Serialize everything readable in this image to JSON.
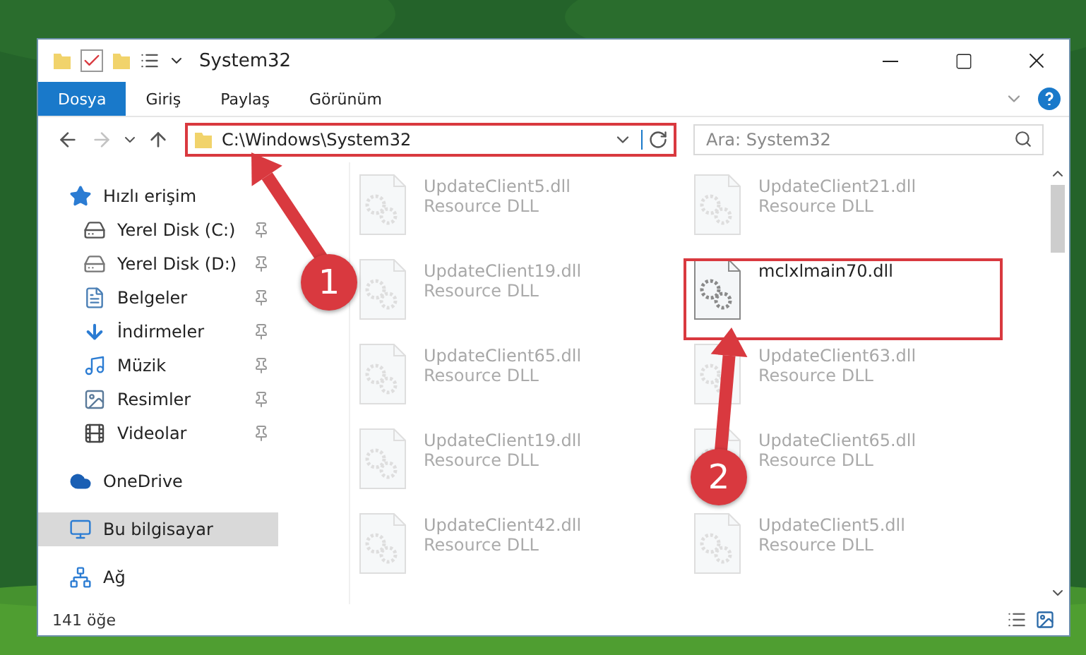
{
  "window": {
    "title": "System32"
  },
  "ribbon": {
    "tabs": [
      {
        "label": "Dosya",
        "selected": true
      },
      {
        "label": "Giriş",
        "selected": false
      },
      {
        "label": "Paylaş",
        "selected": false
      },
      {
        "label": "Görünüm",
        "selected": false
      }
    ]
  },
  "address_bar": {
    "path": "C:\\Windows\\System32",
    "search": {
      "placeholder": "Ara: System32"
    }
  },
  "sidebar": {
    "items": [
      {
        "label": "Hızlı erişim",
        "kind": "quick",
        "selected": false,
        "children": [
          {
            "label": "Yerel Disk (C:)",
            "kind": "system-drive",
            "pinned": true
          },
          {
            "label": "Yerel Disk (D:)",
            "kind": "drive",
            "pinned": true
          },
          {
            "label": "Belgeler",
            "kind": "documents",
            "pinned": true
          },
          {
            "label": "İndirmeler",
            "kind": "downloads",
            "pinned": true
          },
          {
            "label": "Müzik",
            "kind": "music",
            "pinned": true
          },
          {
            "label": "Resimler",
            "kind": "pictures",
            "pinned": true
          },
          {
            "label": "Videolar",
            "kind": "videos",
            "pinned": true
          }
        ]
      },
      {
        "label": "OneDrive",
        "kind": "cloud",
        "selected": false
      },
      {
        "label": "Bu bilgisayar",
        "kind": "computer",
        "selected": true
      },
      {
        "label": "Ağ",
        "kind": "network",
        "selected": false
      }
    ]
  },
  "files": [
    {
      "name": "UpdateClient5.dll",
      "type": "Resource DLL",
      "faded": true
    },
    {
      "name": "UpdateClient21.dll",
      "type": "Resource DLL",
      "faded": true
    },
    {
      "name": "UpdateClient19.dll",
      "type": "Resource DLL",
      "faded": true
    },
    {
      "name": "mclxlmain70.dll",
      "faded": false
    },
    {
      "name": "UpdateClient65.dll",
      "type": "Resource DLL",
      "faded": true
    },
    {
      "name": "UpdateClient63.dll",
      "type": "Resource DLL",
      "faded": true
    },
    {
      "name": "UpdateClient19.dll",
      "type": "Resource DLL",
      "faded": true
    },
    {
      "name": "UpdateClient65.dll",
      "type": "Resource DLL",
      "faded": true
    },
    {
      "name": "UpdateClient42.dll",
      "type": "Resource DLL",
      "faded": true
    },
    {
      "name": "UpdateClient5.dll",
      "type": "Resource DLL",
      "faded": true
    }
  ],
  "status_bar": {
    "count": "141 öğe"
  },
  "annotations": [
    {
      "label": "1"
    },
    {
      "label": "2"
    }
  ]
}
